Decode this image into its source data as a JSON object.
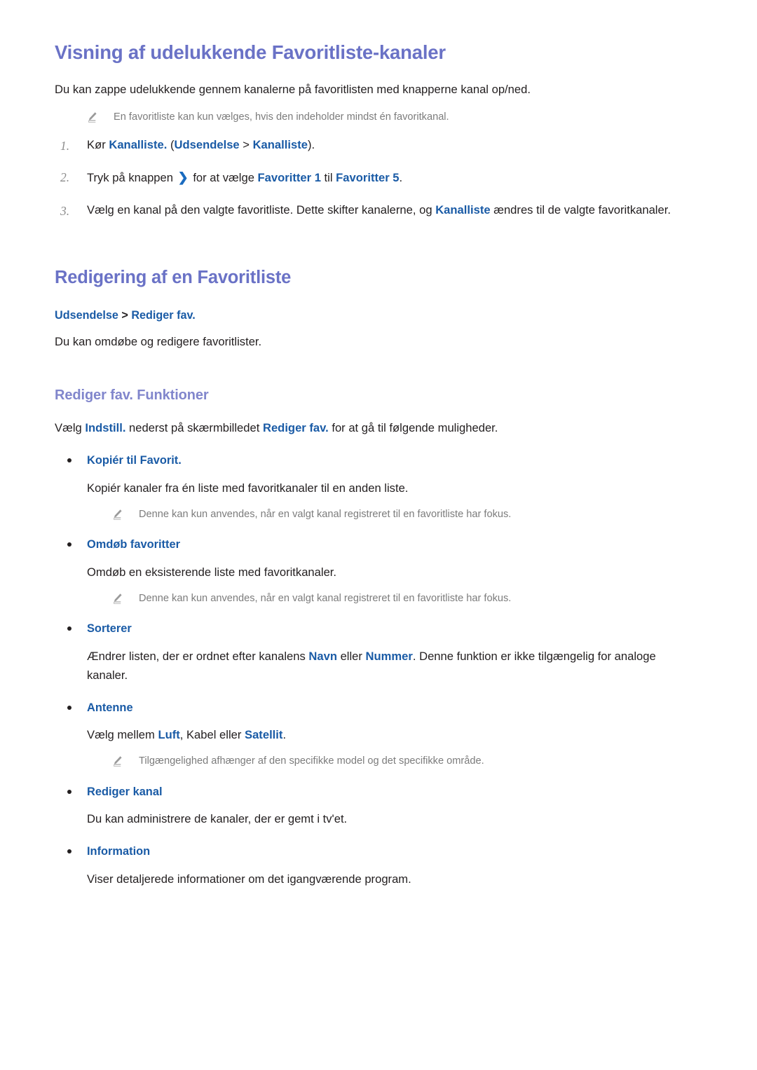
{
  "colors": {
    "heading_primary": "#6a72c6",
    "heading_tertiary": "#8186cc",
    "keyword_blue": "#1a5ba6",
    "body_text": "#231f20",
    "note_text": "#7c7c7c",
    "number_marker": "#8d8d8d"
  },
  "section1": {
    "heading": "Visning af udelukkende Favoritliste-kanaler",
    "intro": "Du kan zappe udelukkende gennem kanalerne på favoritlisten med knapperne kanal op/ned.",
    "note": "En favoritliste kan kun vælges, hvis den indeholder mindst én favoritkanal.",
    "steps": [
      {
        "marker": "1.",
        "parts": [
          {
            "text": "Kør ",
            "style": "plain"
          },
          {
            "text": "Kanalliste.",
            "style": "keyword"
          },
          {
            "text": " (",
            "style": "plain"
          },
          {
            "text": "Udsendelse",
            "style": "keyword"
          },
          {
            "text": " > ",
            "style": "plain"
          },
          {
            "text": "Kanalliste",
            "style": "keyword"
          },
          {
            "text": ").",
            "style": "plain"
          }
        ]
      },
      {
        "marker": "2.",
        "parts": [
          {
            "text": "Tryk på knappen ",
            "style": "plain"
          },
          {
            "text": "❯",
            "style": "chevron"
          },
          {
            "text": " for at vælge ",
            "style": "plain"
          },
          {
            "text": "Favoritter 1",
            "style": "keyword"
          },
          {
            "text": " til ",
            "style": "plain"
          },
          {
            "text": "Favoritter 5",
            "style": "keyword"
          },
          {
            "text": ".",
            "style": "plain"
          }
        ]
      },
      {
        "marker": "3.",
        "parts": [
          {
            "text": "Vælg en kanal på den valgte favoritliste. Dette skifter kanalerne, og ",
            "style": "plain"
          },
          {
            "text": "Kanalliste",
            "style": "keyword"
          },
          {
            "text": " ændres til de valgte favoritkanaler.",
            "style": "plain"
          }
        ]
      }
    ]
  },
  "section2": {
    "heading": "Redigering af en Favoritliste",
    "path": {
      "first": "Udsendelse",
      "separator": " > ",
      "second": "Rediger fav."
    },
    "intro": "Du kan omdøbe og redigere favoritlister.",
    "subheading": "Rediger fav. Funktioner",
    "subintro_parts": [
      {
        "text": "Vælg ",
        "style": "plain"
      },
      {
        "text": "Indstill.",
        "style": "keyword"
      },
      {
        "text": " nederst på skærmbilledet ",
        "style": "plain"
      },
      {
        "text": "Rediger fav.",
        "style": "keyword"
      },
      {
        "text": " for at gå til følgende muligheder.",
        "style": "plain"
      }
    ],
    "options": [
      {
        "title": "Kopiér til Favorit.",
        "body_parts": [
          {
            "text": "Kopiér kanaler fra én liste med favoritkanaler til en anden liste.",
            "style": "plain"
          }
        ],
        "note": "Denne kan kun anvendes, når en valgt kanal registreret til en favoritliste har fokus."
      },
      {
        "title": "Omdøb favoritter",
        "body_parts": [
          {
            "text": "Omdøb en eksisterende liste med favoritkanaler.",
            "style": "plain"
          }
        ],
        "note": "Denne kan kun anvendes, når en valgt kanal registreret til en favoritliste har fokus."
      },
      {
        "title": "Sorterer",
        "body_parts": [
          {
            "text": "Ændrer listen, der er ordnet efter kanalens ",
            "style": "plain"
          },
          {
            "text": "Navn",
            "style": "keyword"
          },
          {
            "text": " eller ",
            "style": "plain"
          },
          {
            "text": "Nummer",
            "style": "keyword"
          },
          {
            "text": ". Denne funktion er ikke tilgængelig for analoge kanaler.",
            "style": "plain"
          }
        ],
        "note": null
      },
      {
        "title": "Antenne",
        "body_parts": [
          {
            "text": "Vælg mellem ",
            "style": "plain"
          },
          {
            "text": "Luft",
            "style": "keyword"
          },
          {
            "text": ", Kabel  eller ",
            "style": "plain"
          },
          {
            "text": "Satellit",
            "style": "keyword"
          },
          {
            "text": ".",
            "style": "plain"
          }
        ],
        "note": "Tilgængelighed afhænger af den specifikke model og det specifikke område."
      },
      {
        "title": "Rediger kanal",
        "body_parts": [
          {
            "text": "Du kan administrere de kanaler, der er gemt i tv'et.",
            "style": "plain"
          }
        ],
        "note": null
      },
      {
        "title": "Information",
        "body_parts": [
          {
            "text": "Viser detaljerede informationer om det igangværende program.",
            "style": "plain"
          }
        ],
        "note": null
      }
    ]
  }
}
